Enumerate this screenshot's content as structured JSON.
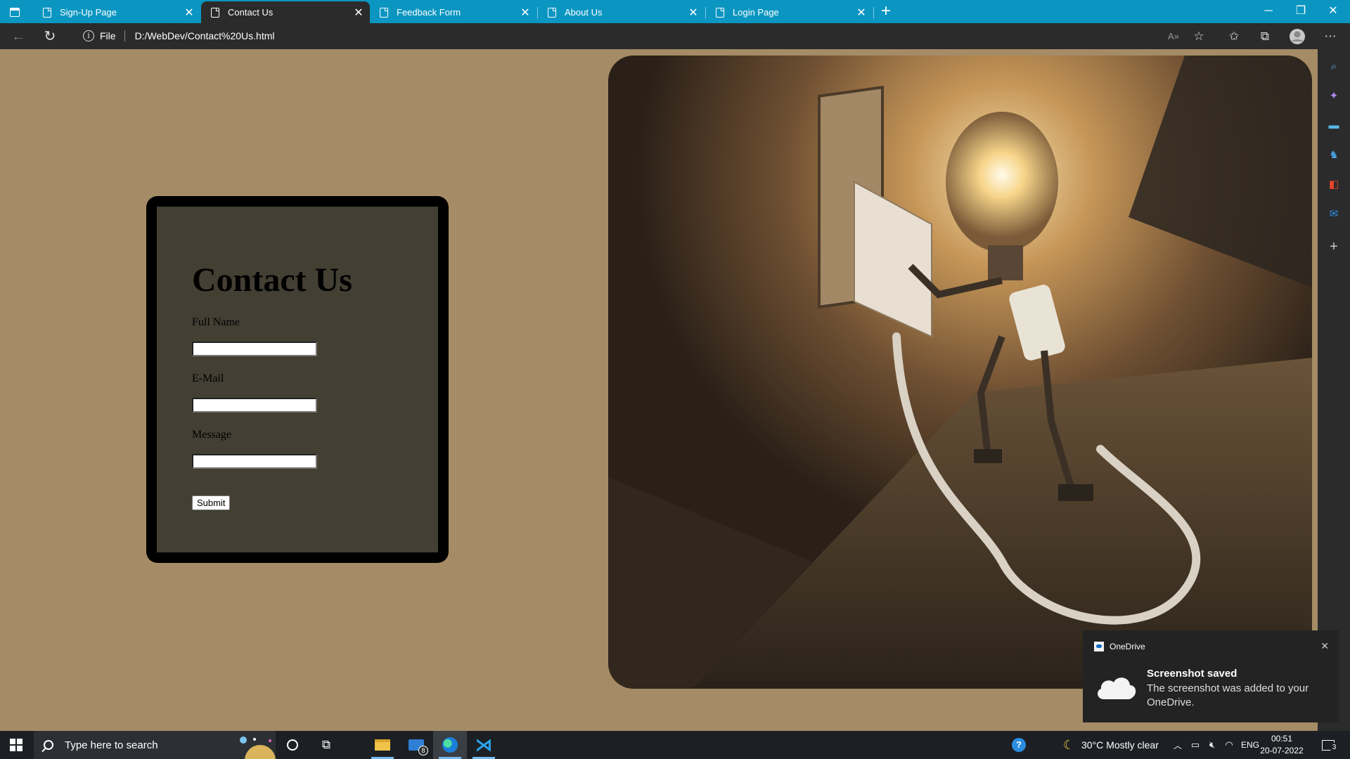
{
  "browser": {
    "tabs": [
      {
        "label": "Sign-Up Page",
        "active": false
      },
      {
        "label": "Contact Us",
        "active": true
      },
      {
        "label": "Feedback Form",
        "active": false
      },
      {
        "label": "About Us",
        "active": false
      },
      {
        "label": "Login Page",
        "active": false
      }
    ],
    "address": {
      "scheme_label": "File",
      "url": "D:/WebDev/Contact%20Us.html"
    }
  },
  "page": {
    "title": "Contact Us",
    "fields": [
      {
        "label": "Full Name",
        "value": ""
      },
      {
        "label": "E-Mail",
        "value": ""
      },
      {
        "label": "Message",
        "value": ""
      }
    ],
    "submit_label": "Submit",
    "background_color": "#a58c66",
    "card_color": "#433f33",
    "hero_image_icon": "light-bulb-robot-plugging-socket-photo"
  },
  "toast": {
    "app": "OneDrive",
    "title": "Screenshot saved",
    "body": "The screenshot was added to your OneDrive."
  },
  "taskbar": {
    "search_placeholder": "Type here to search",
    "mail_badge": "8",
    "weather": "30°C  Mostly clear",
    "language": "ENG",
    "time": "00:51",
    "date": "20-07-2022",
    "notifications": "3"
  }
}
